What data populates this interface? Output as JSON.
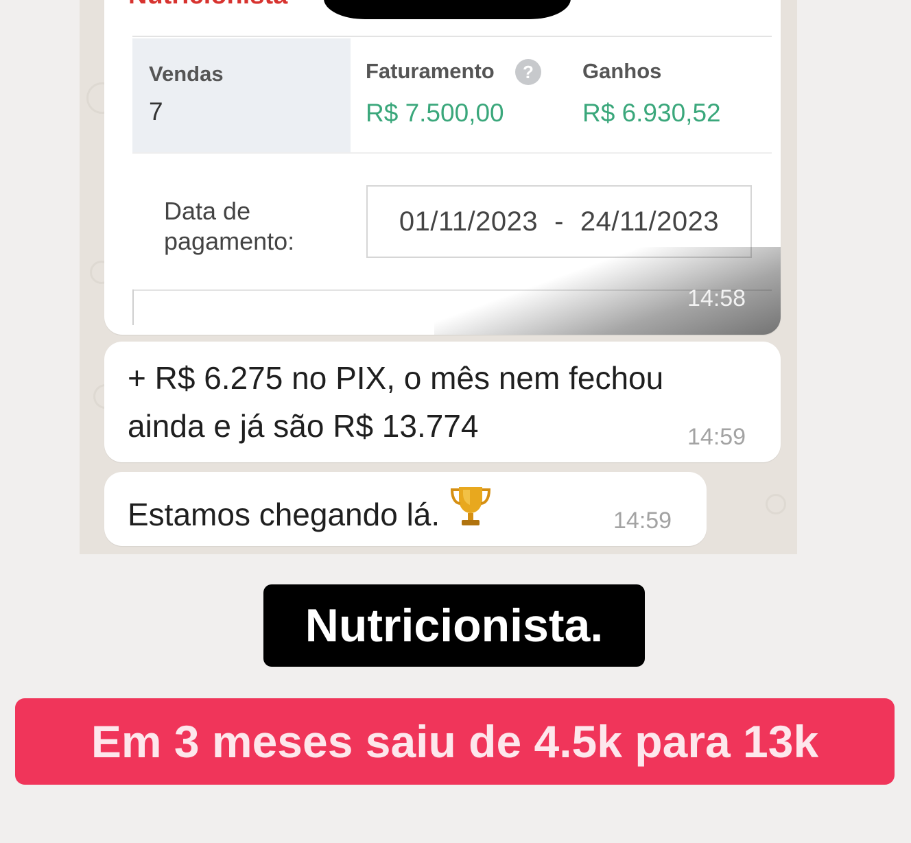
{
  "header": {
    "title": "Nutricionista"
  },
  "dashboard": {
    "sales_label": "Vendas",
    "sales_value": "7",
    "revenue_label": "Faturamento",
    "revenue_value": "R$ 7.500,00",
    "earnings_label": "Ganhos",
    "earnings_value": "R$ 6.930,52",
    "payment_date_label": "Data de\npagamento:",
    "date_start": "01/11/2023",
    "date_separator": "-",
    "date_end": "24/11/2023",
    "help_icon": "?"
  },
  "messages": [
    {
      "time": "14:58"
    },
    {
      "line1": "+ R$ 6.275 no PIX, o mês nem fechou",
      "line2": "ainda e já são R$ 13.774",
      "time": "14:59"
    },
    {
      "text": "Estamos chegando lá.",
      "emoji": "trophy-icon",
      "time": "14:59"
    }
  ],
  "captions": {
    "title": "Nutricionista.",
    "highlight": "Em 3 meses saiu de 4.5k para 13k"
  },
  "colors": {
    "accent_red": "#f0355a",
    "green_value": "#3aa77b",
    "title_red": "#d7332f"
  }
}
